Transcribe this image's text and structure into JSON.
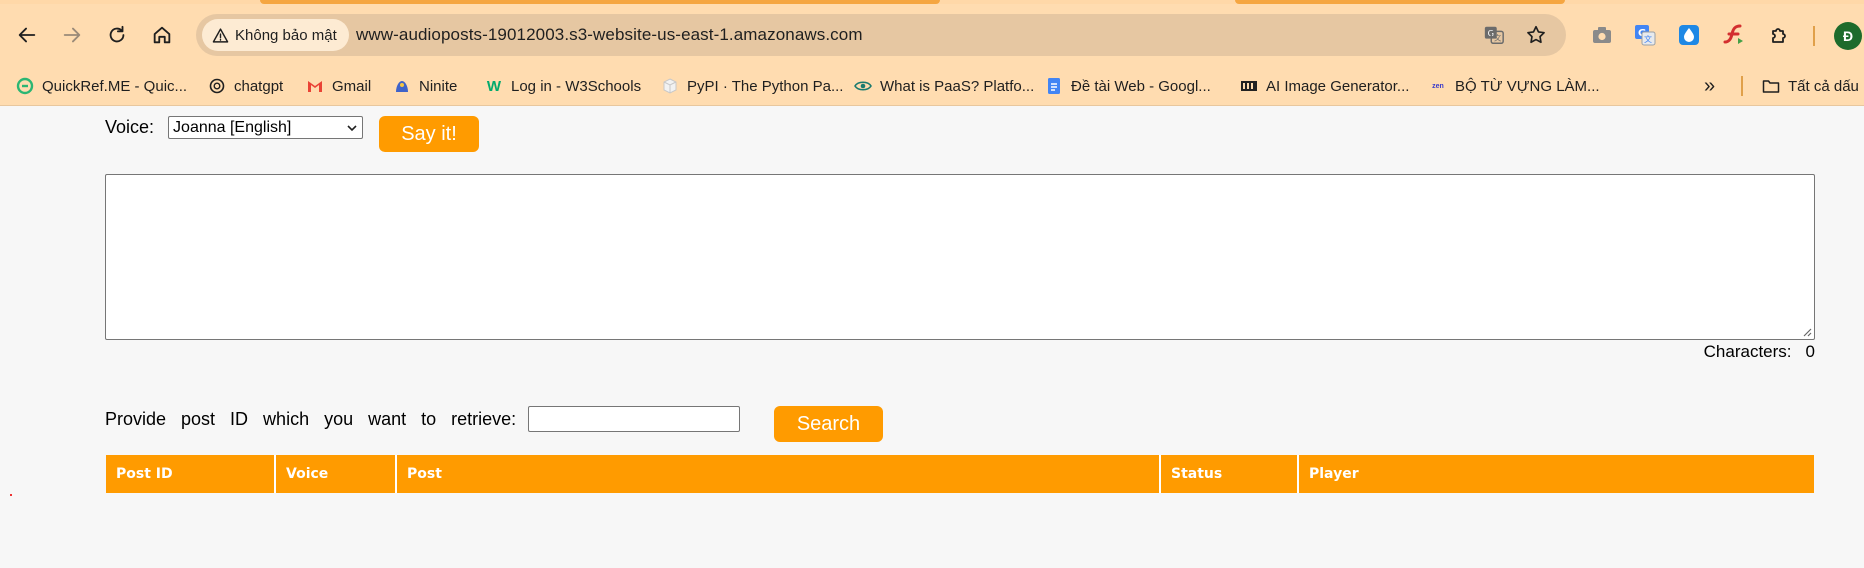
{
  "browser": {
    "security_label": "Không bảo mật",
    "url": "www-audioposts-19012003.s3-website-us-east-1.amazonaws.com",
    "profile_initial": "Đ",
    "icons": {
      "back": "back-arrow-icon",
      "forward": "forward-arrow-icon",
      "reload": "reload-icon",
      "home": "home-icon",
      "translate": "translate-icon",
      "bookmark_star": "star-icon",
      "extensions": [
        "camera-icon",
        "google-translate-icon",
        "water-drop-icon",
        "flash-icon",
        "puzzle-icon"
      ]
    }
  },
  "bookmarks": [
    {
      "label": "QuickRef.ME - Quic...",
      "icon": "quickref-icon"
    },
    {
      "label": "chatgpt",
      "icon": "openai-icon"
    },
    {
      "label": "Gmail",
      "icon": "gmail-icon"
    },
    {
      "label": "Ninite",
      "icon": "ninite-icon"
    },
    {
      "label": "Log in - W3Schools",
      "icon": "w3schools-icon"
    },
    {
      "label": "PyPI · The Python Pa...",
      "icon": "pypi-icon"
    },
    {
      "label": "What is PaaS? Platfo...",
      "icon": "eye-icon"
    },
    {
      "label": "Đề tài Web - Googl...",
      "icon": "google-docs-icon"
    },
    {
      "label": "AI Image Generator...",
      "icon": "ai-image-icon"
    },
    {
      "label": "BỘ TỪ VỰNG LÀM...",
      "icon": "zenlish-icon"
    }
  ],
  "bookmarks_overflow": "»",
  "bookmarks_folder": {
    "label": "Tất cả dấu",
    "icon": "folder-icon"
  },
  "form": {
    "voice_label": "Voice:",
    "voice_selected": "Joanna [English]",
    "say_button": "Say it!",
    "post_text": "",
    "characters_label": "Characters:",
    "characters_count": "0",
    "search_label": "Provide post ID which you want to retrieve:",
    "search_value": "",
    "search_button": "Search"
  },
  "table": {
    "headers": [
      "Post ID",
      "Voice",
      "Post",
      "Status",
      "Player"
    ],
    "rows": []
  },
  "colors": {
    "accent": "#ff9b00",
    "chrome": "#ffdcb0",
    "page_bg": "#f7f7f7"
  }
}
